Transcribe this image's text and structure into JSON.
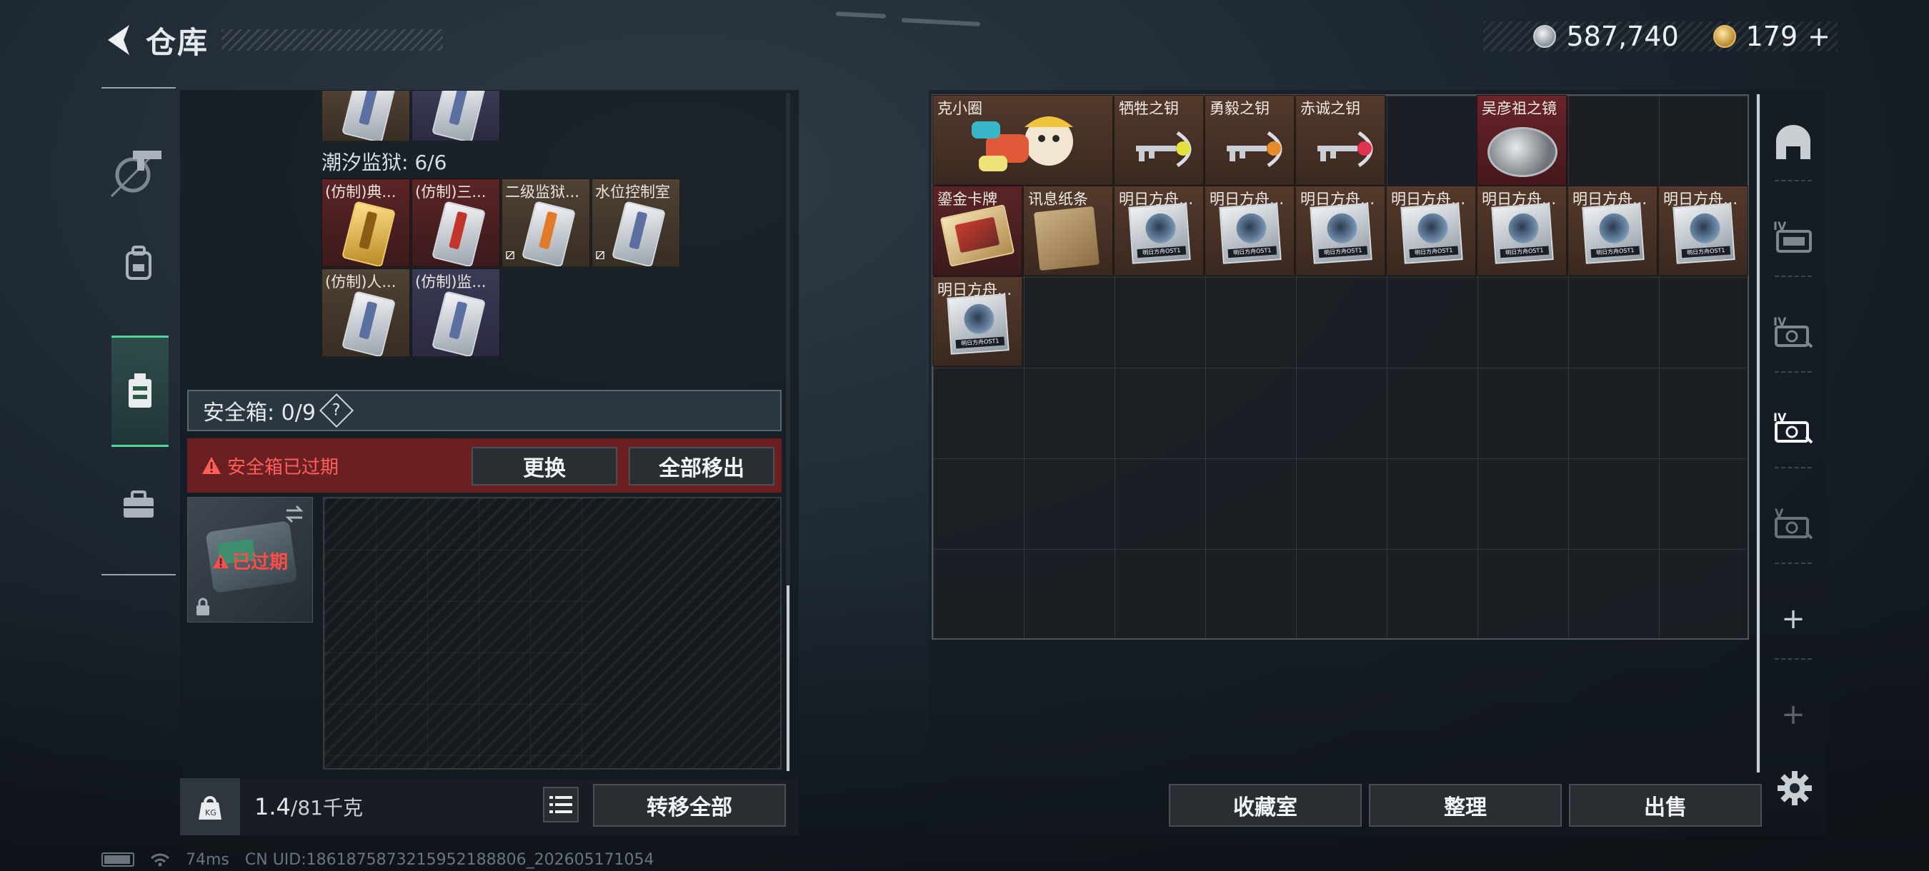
{
  "header": {
    "title": "仓库"
  },
  "currency": {
    "silver": "587,740",
    "gold": "179",
    "gold_suffix": "+"
  },
  "left_nav": [
    "gun-icon",
    "backpack-icon",
    "vest-icon",
    "toolbox-icon"
  ],
  "stash": {
    "section_title": "潮汐监狱: 6/6",
    "items": [
      {
        "label": "(仿制)典...",
        "color": "#5b2426"
      },
      {
        "label": "(仿制)三...",
        "color": "#5b2426"
      },
      {
        "label": "二级监狱...",
        "color": "#4f4133"
      },
      {
        "label": "水位控制室",
        "color": "#4f4133"
      },
      {
        "label": "(仿制)人...",
        "color": "#4f4133"
      },
      {
        "label": "(仿制)监...",
        "color": "#3b3a55"
      }
    ]
  },
  "safebox": {
    "title": "安全箱: 0/9",
    "help": "?",
    "expired_notice": "安全箱已过期",
    "replace_label": "更换",
    "remove_all_label": "全部移出",
    "case_status": "已过期"
  },
  "bottom": {
    "weight_current": "1.4",
    "weight_max": "/81千克",
    "transfer_all_label": "转移全部"
  },
  "storage_items": [
    {
      "label": "克小圈"
    },
    {
      "label": "牺牲之钥",
      "gem": "#e4e23a"
    },
    {
      "label": "勇毅之钥",
      "gem": "#e88a2a"
    },
    {
      "label": "赤诚之钥",
      "gem": "#e2324f"
    },
    {
      "label": "吴彦祖之镜"
    },
    {
      "label": "鎏金卡牌"
    },
    {
      "label": "讯息纸条"
    },
    {
      "label": "明日方舟..."
    },
    {
      "label": "明日方舟..."
    },
    {
      "label": "明日方舟..."
    },
    {
      "label": "明日方舟..."
    },
    {
      "label": "明日方舟..."
    },
    {
      "label": "明日方舟..."
    },
    {
      "label": "明日方舟..."
    },
    {
      "label": "明日方舟..."
    }
  ],
  "ost_tag": "明日方舟OST1",
  "right_nav": [
    "helmet-icon",
    "iv-1",
    "iv-2",
    "iv-3",
    "v-1",
    "+",
    "+"
  ],
  "actions": {
    "collection": "收藏室",
    "sort": "整理",
    "sell": "出售"
  },
  "status": {
    "ping": "74ms",
    "uid": "CN UID:1861875873215952188806_202605171054"
  },
  "colors": {
    "accent": "#52d39a",
    "danger": "#ff5f5a",
    "danger_bg": "#6a1f22"
  }
}
